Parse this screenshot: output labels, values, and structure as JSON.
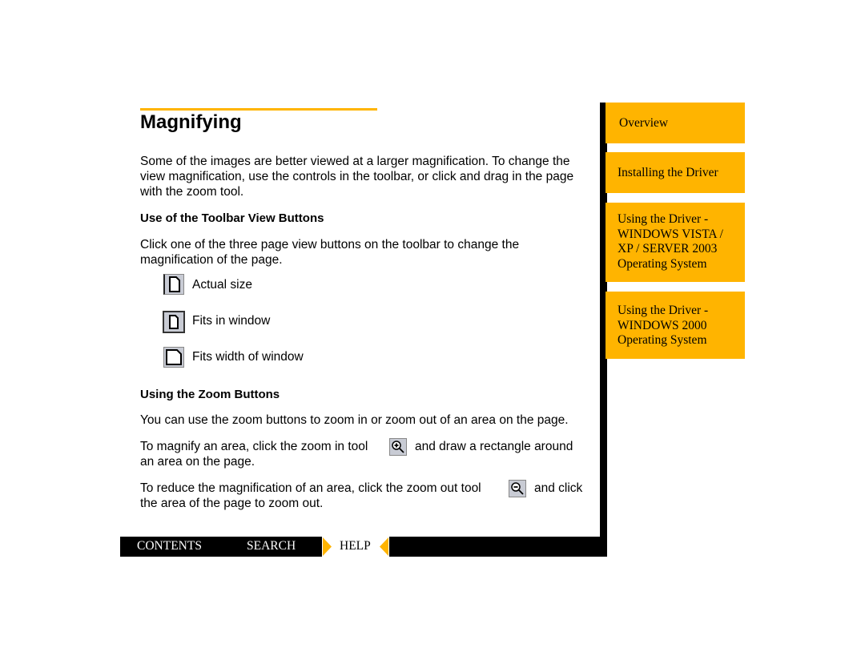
{
  "title": "Magnifying",
  "intro": "Some of the images are better viewed at a larger magnification. To change the view magnification, use the controls in the toolbar, or click and drag in the page with the zoom tool.",
  "section1": {
    "heading": "Use of the Toolbar View Buttons",
    "text": "Click one of the three page view buttons on the toolbar to change the magnification of the page.",
    "items": [
      {
        "icon": "actual-size-icon",
        "label": "Actual size"
      },
      {
        "icon": "fit-window-icon",
        "label": "Fits in window"
      },
      {
        "icon": "fit-width-icon",
        "label": "Fits width of window"
      }
    ]
  },
  "section2": {
    "heading": "Using the Zoom Buttons",
    "text": "You can use the zoom buttons to zoom in or zoom out of an area on the page.",
    "zoom_in_a": "To magnify an area, click the zoom in tool",
    "zoom_in_b": "and draw a rectangle around",
    "zoom_in_c": "an area on the page.",
    "zoom_out_a": "To reduce the magnification of an area, click the zoom out tool",
    "zoom_out_b": "and click",
    "zoom_out_c": "the area of the page to zoom out."
  },
  "sidebar": {
    "items": [
      {
        "l1": "Overview"
      },
      {
        "l1": "Installing the Driver"
      },
      {
        "l1": "Using the Driver -",
        "l2": "WINDOWS VISTA /",
        "l3": "XP / SERVER 2003",
        "l4": "Operating System"
      },
      {
        "l1": "Using the Driver -",
        "l2": "WINDOWS 2000",
        "l3": "Operating System"
      }
    ]
  },
  "footer": {
    "contents": "CONTENTS",
    "search": "SEARCH",
    "help": "HELP"
  },
  "colors": {
    "accent": "#ffb400"
  }
}
